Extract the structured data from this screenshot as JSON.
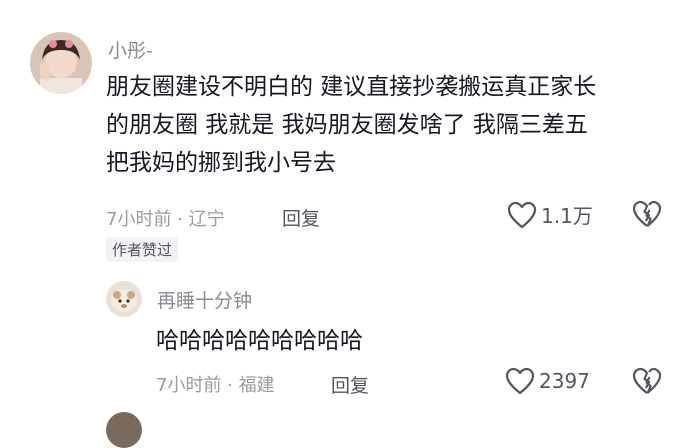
{
  "comment1": {
    "username": "小彤-",
    "lines": [
      "朋友圈建设不明白的 建议直接抄袭搬运真正家长",
      "的朋友圈 我就是 我妈朋友圈发啥了 我隔三差五",
      "把我妈的挪到我小号去"
    ],
    "time_location": "7小时前 · 辽宁",
    "reply_label": "回复",
    "like_count": "1.1万",
    "author_badge": "作者赞过"
  },
  "reply1": {
    "username": "再睡十分钟",
    "text": "哈哈哈哈哈哈哈哈哈",
    "time_location": "7小时前 · 福建",
    "reply_label": "回复",
    "like_count": "2397"
  }
}
